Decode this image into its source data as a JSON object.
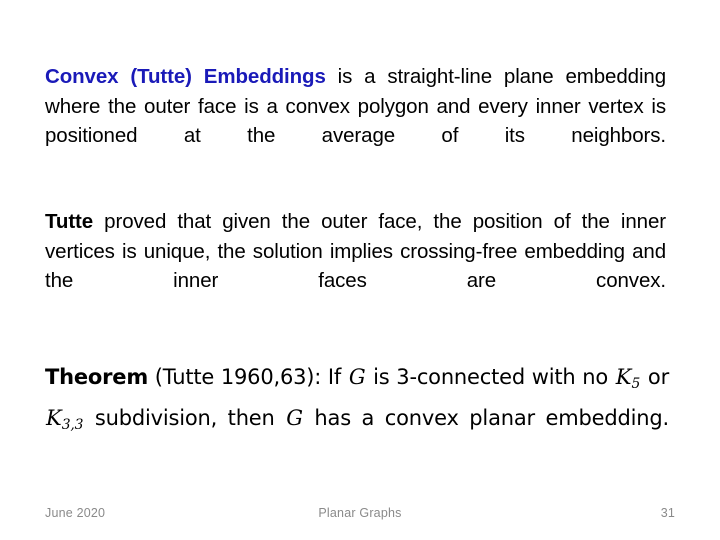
{
  "slide": {
    "background_color": "#ffffff",
    "accent_color": "#1a1ab8",
    "body_color": "#000000",
    "footer_color": "#8a8a8a"
  },
  "content": {
    "paragraph_1": {
      "lead_in": "Convex (Tutte) Embeddings",
      "rest": " is a straight-line plane embedding where the outer face is a convex polygon and every inner vertex is positioned at the average of its neighbors."
    },
    "paragraph_2": {
      "lead_in": "Tutte",
      "rest": " proved that given the outer face, the position of the inner vertices is unique, the solution implies crossing-free embedding and the inner faces are convex."
    },
    "theorem": {
      "label": "Theorem",
      "attribution": " (Tutte 1960,63): If ",
      "symbol_g_1": "G",
      "clause_1": " is 3-connected with no ",
      "symbol_k5_base": "K",
      "symbol_k5_sub": "5",
      "conjunction": " or ",
      "symbol_k33_base": "K",
      "symbol_k33_sub": "3,3",
      "clause_2": " subdivision, then ",
      "symbol_g_2": "G",
      "clause_3": " has a convex planar embedding."
    }
  },
  "footer": {
    "date": "June 2020",
    "title": "Planar Graphs",
    "page_number": "31"
  }
}
